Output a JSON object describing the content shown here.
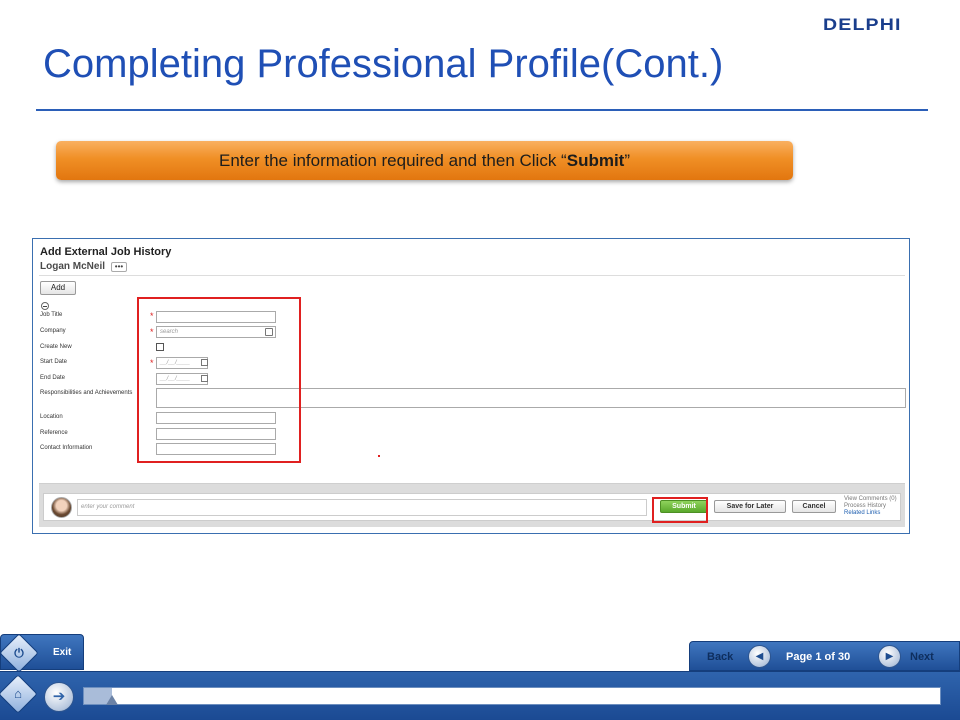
{
  "header": {
    "logo": "DELPHI",
    "title": "Completing Professional Profile(Cont.)"
  },
  "instruction": {
    "prefix": "Enter the information  required and then Click “",
    "bold": "Submit",
    "suffix": "”"
  },
  "form": {
    "title": "Add External Job History",
    "user": "Logan McNeil",
    "more_label": "•••",
    "add_label": "Add",
    "required_mark": "*",
    "labels": {
      "job_title": "Job Title",
      "company": "Company",
      "create_new": "Create New",
      "start_date": "Start Date",
      "end_date": "End Date",
      "responsibilities": "Responsibilities and Achievements",
      "location": "Location",
      "reference": "Reference",
      "contact": "Contact Information"
    },
    "company_placeholder": "search",
    "date_placeholder": "__/__/____"
  },
  "comment_bar": {
    "placeholder": "enter your comment",
    "submit": "Submit",
    "save": "Save for Later",
    "cancel": "Cancel",
    "view_comments": "View Comments (0)",
    "process_history": "Process History",
    "related_links": "Related Links"
  },
  "player": {
    "exit": "Exit",
    "back": "Back",
    "next": "Next",
    "page_indicator": "Page 1 of 30",
    "progress": 0.033
  },
  "colors": {
    "title_blue": "#1f4fb5",
    "banner_orange": "#f08f25",
    "highlight_red": "#e02020",
    "submit_green": "#5aa82c",
    "player_blue": "#2f64ad"
  },
  "icons": {
    "exit": "power-icon",
    "back": "left-arrow-icon",
    "next": "right-arrow-icon",
    "home": "home-icon",
    "go": "right-arrow-circle-icon"
  }
}
